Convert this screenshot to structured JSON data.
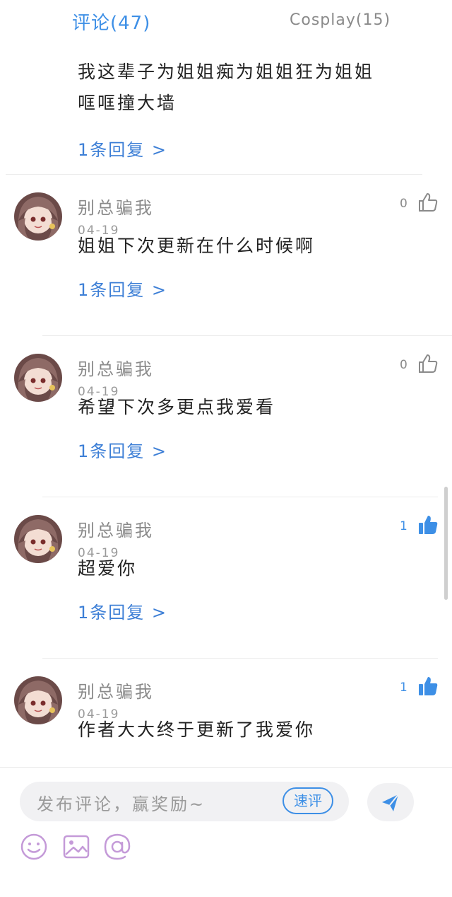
{
  "tabs": {
    "comments": "评论(47)",
    "cosplay": "Cosplay(15)"
  },
  "partial_comment": {
    "text_line1": "我这辈子为姐姐痴为姐姐狂为姐姐",
    "text_line2": "哐哐撞大墙",
    "reply": "1条回复 >"
  },
  "comments": [
    {
      "user": "别总骗我",
      "date": "04-19",
      "text": "姐姐下次更新在什么时候啊",
      "likes": "0",
      "liked": false,
      "reply": "1条回复 >"
    },
    {
      "user": "别总骗我",
      "date": "04-19",
      "text": "希望下次多更点我爱看",
      "likes": "0",
      "liked": false,
      "reply": "1条回复 >"
    },
    {
      "user": "别总骗我",
      "date": "04-19",
      "text": "超爱你",
      "likes": "1",
      "liked": true,
      "reply": "1条回复 >"
    },
    {
      "user": "别总骗我",
      "date": "04-19",
      "text": "作者大大终于更新了我爱你",
      "likes": "1",
      "liked": true,
      "reply": ""
    }
  ],
  "composer": {
    "placeholder": "发布评论，赢奖励~",
    "quick_label": "速评",
    "icons": [
      "emoji-icon",
      "image-icon",
      "mention-icon",
      "send-icon"
    ]
  },
  "colors": {
    "accent": "#3d8fe6",
    "link": "#3d7fd6",
    "muted": "#8a8a8a"
  }
}
